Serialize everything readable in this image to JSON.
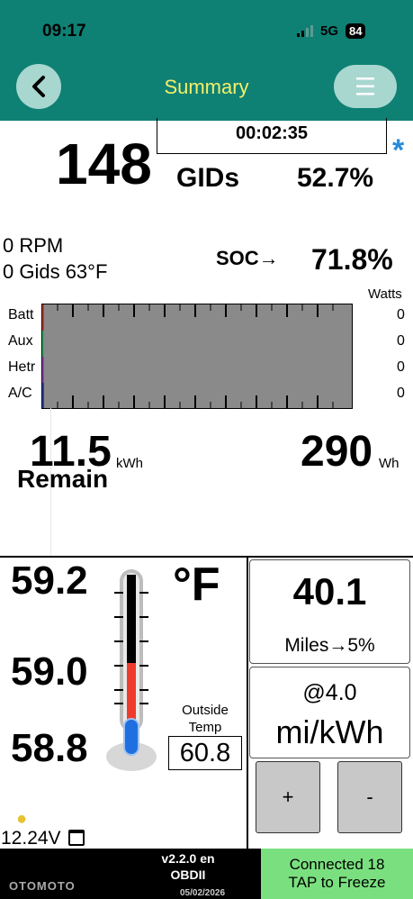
{
  "status": {
    "time": "09:17",
    "network": "5G",
    "battery": "84"
  },
  "header": {
    "title": "Summary",
    "back_icon": "chevron-left-icon",
    "menu_icon": "hamburger-icon",
    "accent": "#0f8074",
    "title_color": "#f3f06a"
  },
  "top": {
    "timer": "00:02:35",
    "gids_value": "148",
    "gids_label": "GIDs",
    "gids_percent": "52.7%",
    "star": "*"
  },
  "status_lines": {
    "rpm": "0 RPM",
    "gids_temp": "0 Gids 63°F"
  },
  "soc": {
    "label": "SOC→",
    "value": "71.8%"
  },
  "power": {
    "watts_label": "Watts",
    "rows": [
      {
        "label": "Batt",
        "value": "0"
      },
      {
        "label": "Aux",
        "value": "0"
      },
      {
        "label": "Hetr",
        "value": "0"
      },
      {
        "label": "A/C",
        "value": "0"
      }
    ]
  },
  "energy": {
    "remain_value": "11.5",
    "remain_unit": "kWh",
    "remain_label": "Remain",
    "wh_value": "290",
    "wh_unit": "Wh"
  },
  "temps": {
    "t1": "59.2",
    "t2": "59.0",
    "t3": "58.8",
    "unit": "°F",
    "outside_label": "Outside Temp",
    "outside_value": "60.8"
  },
  "range": {
    "miles_value": "40.1",
    "miles_label": "Miles→5%",
    "efficiency_value": "@4.0",
    "efficiency_unit": "mi/kWh"
  },
  "buttons": {
    "plus": "+",
    "minus": "-"
  },
  "aux": {
    "voltage": "12.24V"
  },
  "footer": {
    "version_line1": "v2.2.0 en",
    "version_line2": "OBDII",
    "date": "05/02/2026",
    "connection_line1": "Connected 18",
    "connection_line2": "TAP to Freeze",
    "connection_color": "#7ae07f"
  },
  "watermark": "OTOMOTO"
}
